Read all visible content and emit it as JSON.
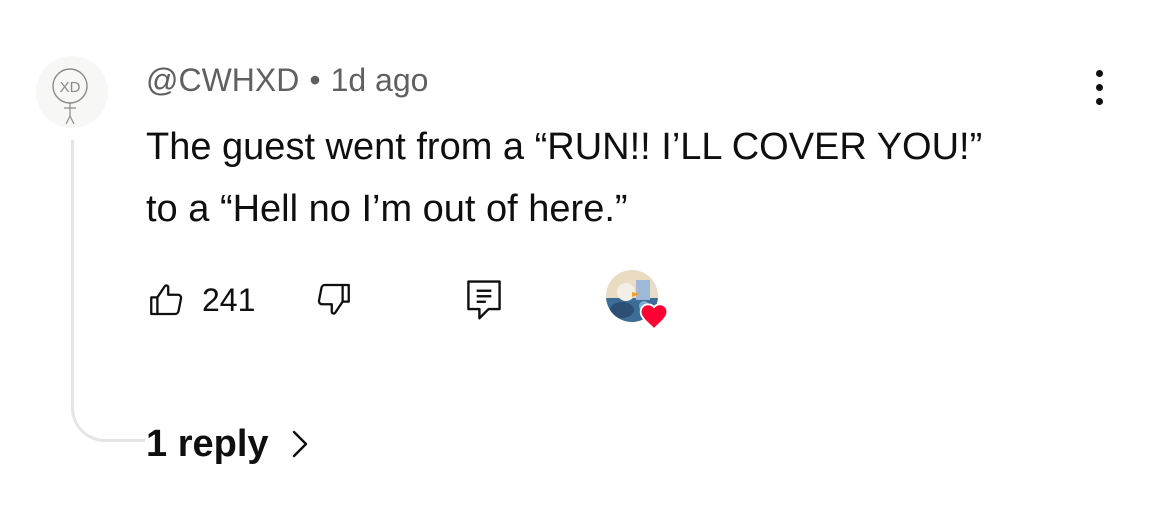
{
  "comment": {
    "author": "@CWHXD",
    "separator": "•",
    "timestamp": "1d ago",
    "text_line1": "The guest went from a “RUN!! I’LL COVER YOU!”",
    "text_line2": "to a “Hell no I’m out of here.”",
    "avatar_text": "XD"
  },
  "actions": {
    "like_count": "241",
    "like_icon": "thumbs-up-icon",
    "dislike_icon": "thumbs-down-icon",
    "reply_icon": "comment-icon",
    "more_icon": "more-vertical-icon",
    "heart_icon": "heart-icon"
  },
  "replies": {
    "label": "1 reply",
    "icon": "chevron-right-icon"
  },
  "colors": {
    "text": "#0f0f0f",
    "meta": "#606060",
    "thread_line": "#e5e5e5",
    "heart": "#ff0033"
  }
}
